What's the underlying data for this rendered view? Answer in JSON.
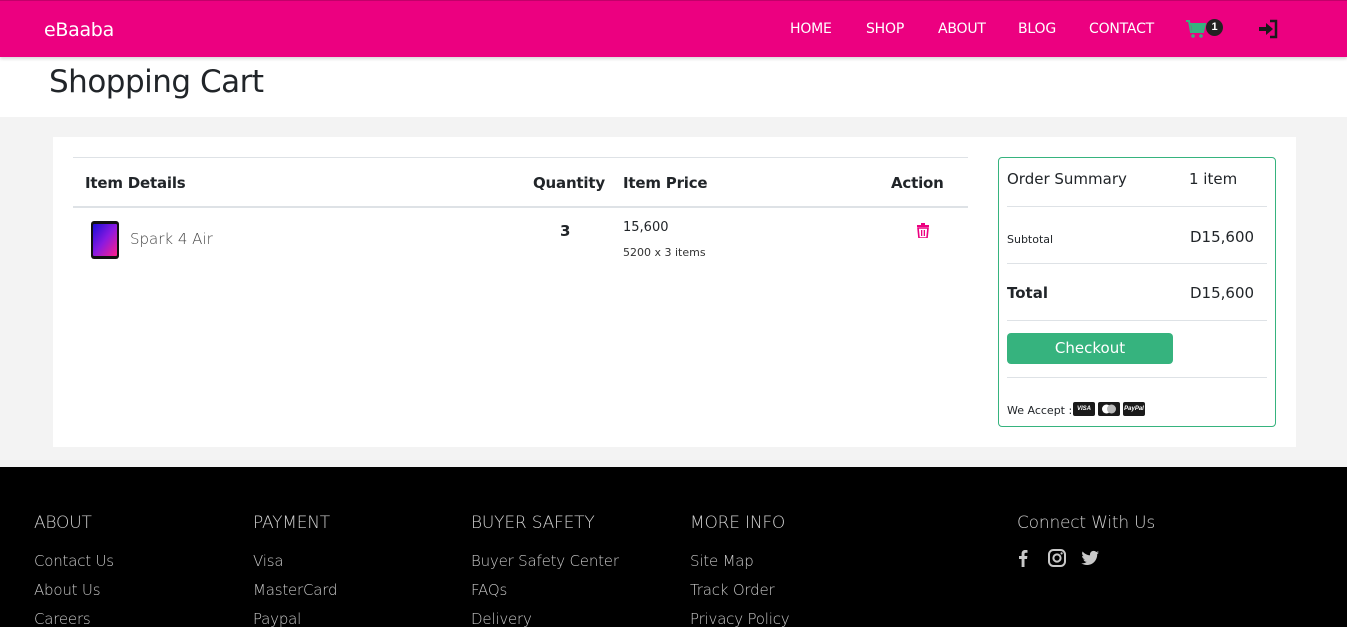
{
  "brand": "eBaaba",
  "nav": {
    "home": "HOME",
    "shop": "SHOP",
    "about": "ABOUT",
    "blog": "BLOG",
    "contact": "CONTACT",
    "cart_count": "1"
  },
  "page_title": "Shopping Cart",
  "cart_table": {
    "headers": {
      "item_details": "Item Details",
      "quantity": "Quantity",
      "item_price": "Item Price",
      "action": "Action"
    },
    "rows": [
      {
        "name": "Spark 4 Air",
        "quantity": "3",
        "price": "15,600",
        "price_detail": "5200 x 3 items"
      }
    ]
  },
  "summary": {
    "title": "Order Summary",
    "item_count": "1 item",
    "subtotal_label": "Subtotal",
    "subtotal_value": "D15,600",
    "total_label": "Total",
    "total_value": "D15,600",
    "checkout_label": "Checkout",
    "we_accept": "We Accept :",
    "cards": [
      "VISA",
      "",
      "PayPal"
    ]
  },
  "footer": {
    "about": {
      "heading": "ABOUT",
      "links": [
        "Contact Us",
        "About Us",
        "Careers"
      ]
    },
    "payment": {
      "heading": "PAYMENT",
      "links": [
        "Visa",
        "MasterCard",
        "Paypal"
      ]
    },
    "buyer_safety": {
      "heading": "BUYER SAFETY",
      "links": [
        "Buyer Safety Center",
        "FAQs",
        "Delivery"
      ]
    },
    "more_info": {
      "heading": "MORE INFO",
      "links": [
        "Site Map",
        "Track Order",
        "Privacy Policy"
      ]
    },
    "connect": {
      "heading": "Connect With Us"
    }
  },
  "colors": {
    "brand_pink": "#ec0080",
    "accent_green": "#36b37e",
    "footer_bg": "#000000"
  }
}
